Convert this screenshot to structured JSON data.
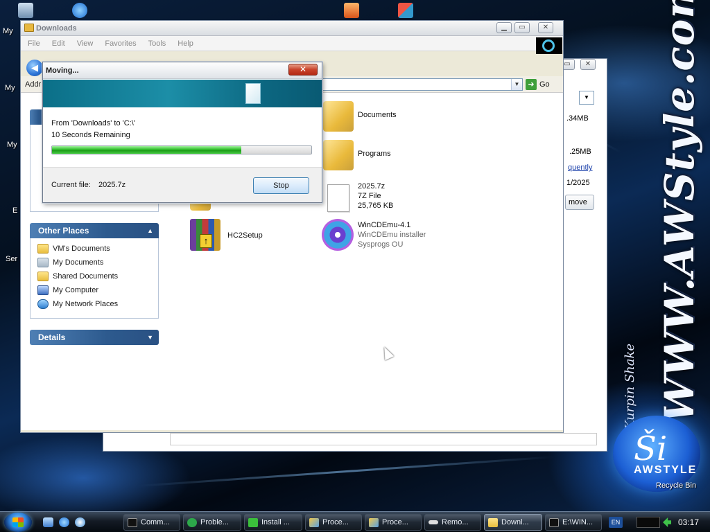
{
  "desktop": {
    "brand_text": "WWW.AWStyle.com",
    "brand_signature": "Kurpin Shake",
    "logo_text": "AWSTYLE",
    "labels": [
      "My",
      "My",
      "My",
      "E",
      "Ser"
    ],
    "recycle_bin": "Recycle Bin"
  },
  "explorer": {
    "title": "Downloads",
    "menu": [
      "File",
      "Edit",
      "View",
      "Favorites",
      "Tools",
      "Help"
    ],
    "address_label": "Addr",
    "go_label": "Go",
    "other_places": {
      "title": "Other Places",
      "items": [
        {
          "label": "VM's Documents",
          "icon": "folder-icon"
        },
        {
          "label": "My Documents",
          "icon": "documents-icon"
        },
        {
          "label": "Shared Documents",
          "icon": "folder-icon"
        },
        {
          "label": "My Computer",
          "icon": "computer-icon"
        },
        {
          "label": "My Network Places",
          "icon": "network-icon"
        }
      ]
    },
    "details_title": "Details",
    "files": {
      "documents": {
        "name": "Documents"
      },
      "programs": {
        "name": "Programs"
      },
      "archive": {
        "name": "2025.7z",
        "type": "7Z File",
        "size": "25,765 KB"
      },
      "hc2setup": {
        "name": "HC2Setup"
      },
      "wincdemu": {
        "name": "WinCDEmu-4.1",
        "desc": "WinCDEmu installer",
        "company": "Sysprogs OU"
      }
    }
  },
  "back_window": {
    "size_1": ".34MB",
    "size_2": ".25MB",
    "link": "quently",
    "date": "1/2025",
    "button": "move"
  },
  "move_dialog": {
    "title": "Moving...",
    "from_to": "From 'Downloads' to 'C:\\'",
    "remaining": "10 Seconds Remaining",
    "progress": 0.73,
    "current_file_label": "Current file:",
    "current_file": "2025.7z",
    "stop_label": "Stop"
  },
  "taskbar": {
    "buttons": [
      {
        "label": "Comm...",
        "icon": "console-icon"
      },
      {
        "label": "Proble...",
        "icon": "problem-icon"
      },
      {
        "label": "Install ...",
        "icon": "install-icon"
      },
      {
        "label": "Proce...",
        "icon": "process-icon"
      },
      {
        "label": "Proce...",
        "icon": "process-icon"
      },
      {
        "label": "Remo...",
        "icon": "remote-icon"
      },
      {
        "label": "Downl...",
        "icon": "folder-icon"
      },
      {
        "label": "E:\\WIN...",
        "icon": "console-icon"
      }
    ],
    "language": "EN",
    "clock": "03:17"
  }
}
